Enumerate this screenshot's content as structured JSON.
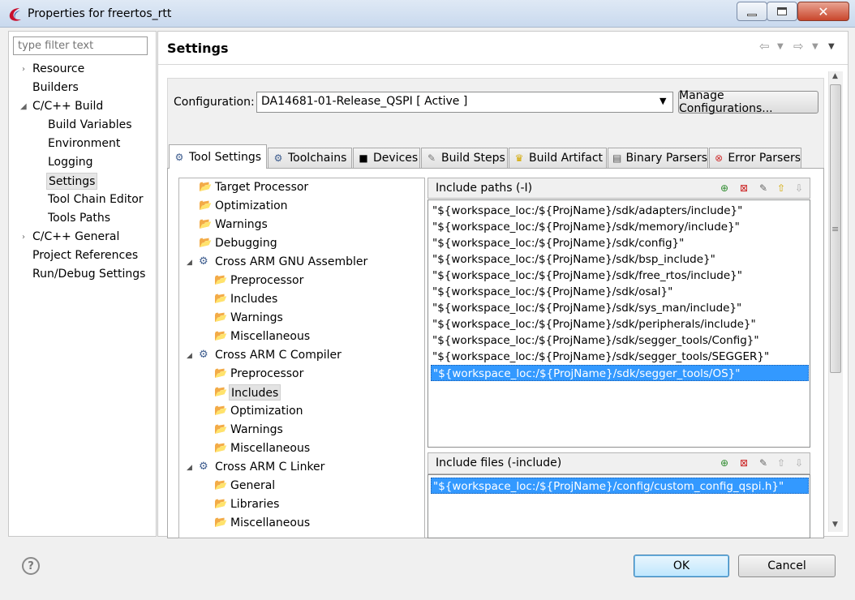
{
  "window": {
    "title": "Properties for freertos_rtt",
    "icon": "eclipse-app-icon",
    "minimize_icon": "minimize-icon",
    "maximize_icon": "maximize-icon",
    "close_icon": "close-icon"
  },
  "filter": {
    "placeholder": "type filter text"
  },
  "nav": {
    "resource": "Resource",
    "builders": "Builders",
    "cpp_build": "C/C++ Build",
    "build_variables": "Build Variables",
    "environment": "Environment",
    "logging": "Logging",
    "settings": "Settings",
    "tool_chain_editor": "Tool Chain Editor",
    "tools_paths": "Tools Paths",
    "cpp_general": "C/C++ General",
    "project_references": "Project References",
    "run_debug_settings": "Run/Debug Settings"
  },
  "header": {
    "title": "Settings"
  },
  "config": {
    "label": "Configuration:",
    "selected": "DA14681-01-Release_QSPI  [ Active ]",
    "manage_label": "Manage Configurations..."
  },
  "tabs": [
    {
      "label": "Tool Settings",
      "icon": "tool-settings-icon"
    },
    {
      "label": "Toolchains",
      "icon": "toolchains-icon"
    },
    {
      "label": "Devices",
      "icon": "devices-icon"
    },
    {
      "label": "Build Steps",
      "icon": "build-steps-icon"
    },
    {
      "label": "Build Artifact",
      "icon": "build-artifact-icon"
    },
    {
      "label": "Binary Parsers",
      "icon": "binary-parsers-icon"
    },
    {
      "label": "Error Parsers",
      "icon": "error-parsers-icon"
    }
  ],
  "tree": {
    "target_processor": "Target Processor",
    "optimization": "Optimization",
    "warnings": "Warnings",
    "debugging": "Debugging",
    "assembler": "Cross ARM GNU Assembler",
    "asm_preprocessor": "Preprocessor",
    "asm_includes": "Includes",
    "asm_warnings": "Warnings",
    "asm_misc": "Miscellaneous",
    "c_compiler": "Cross ARM C Compiler",
    "cc_preprocessor": "Preprocessor",
    "cc_includes": "Includes",
    "cc_optimization": "Optimization",
    "cc_warnings": "Warnings",
    "cc_misc": "Miscellaneous",
    "linker": "Cross ARM C Linker",
    "ld_general": "General",
    "ld_libraries": "Libraries",
    "ld_misc": "Miscellaneous"
  },
  "include_paths": {
    "title": "Include paths (-I)",
    "items": [
      "\"${workspace_loc:/${ProjName}/sdk/adapters/include}\"",
      "\"${workspace_loc:/${ProjName}/sdk/memory/include}\"",
      "\"${workspace_loc:/${ProjName}/sdk/config}\"",
      "\"${workspace_loc:/${ProjName}/sdk/bsp_include}\"",
      "\"${workspace_loc:/${ProjName}/sdk/free_rtos/include}\"",
      "\"${workspace_loc:/${ProjName}/sdk/osal}\"",
      "\"${workspace_loc:/${ProjName}/sdk/sys_man/include}\"",
      "\"${workspace_loc:/${ProjName}/sdk/peripherals/include}\"",
      "\"${workspace_loc:/${ProjName}/sdk/segger_tools/Config}\"",
      "\"${workspace_loc:/${ProjName}/sdk/segger_tools/SEGGER}\"",
      "\"${workspace_loc:/${ProjName}/sdk/segger_tools/OS}\""
    ]
  },
  "include_files": {
    "title": "Include files (-include)",
    "items": [
      "\"${workspace_loc:/${ProjName}/config/custom_config_qspi.h}\""
    ]
  },
  "buttons": {
    "ok": "OK",
    "cancel": "Cancel",
    "help": "?"
  },
  "colors": {
    "selection": "#3399ff",
    "folder": "#c57f0a"
  }
}
